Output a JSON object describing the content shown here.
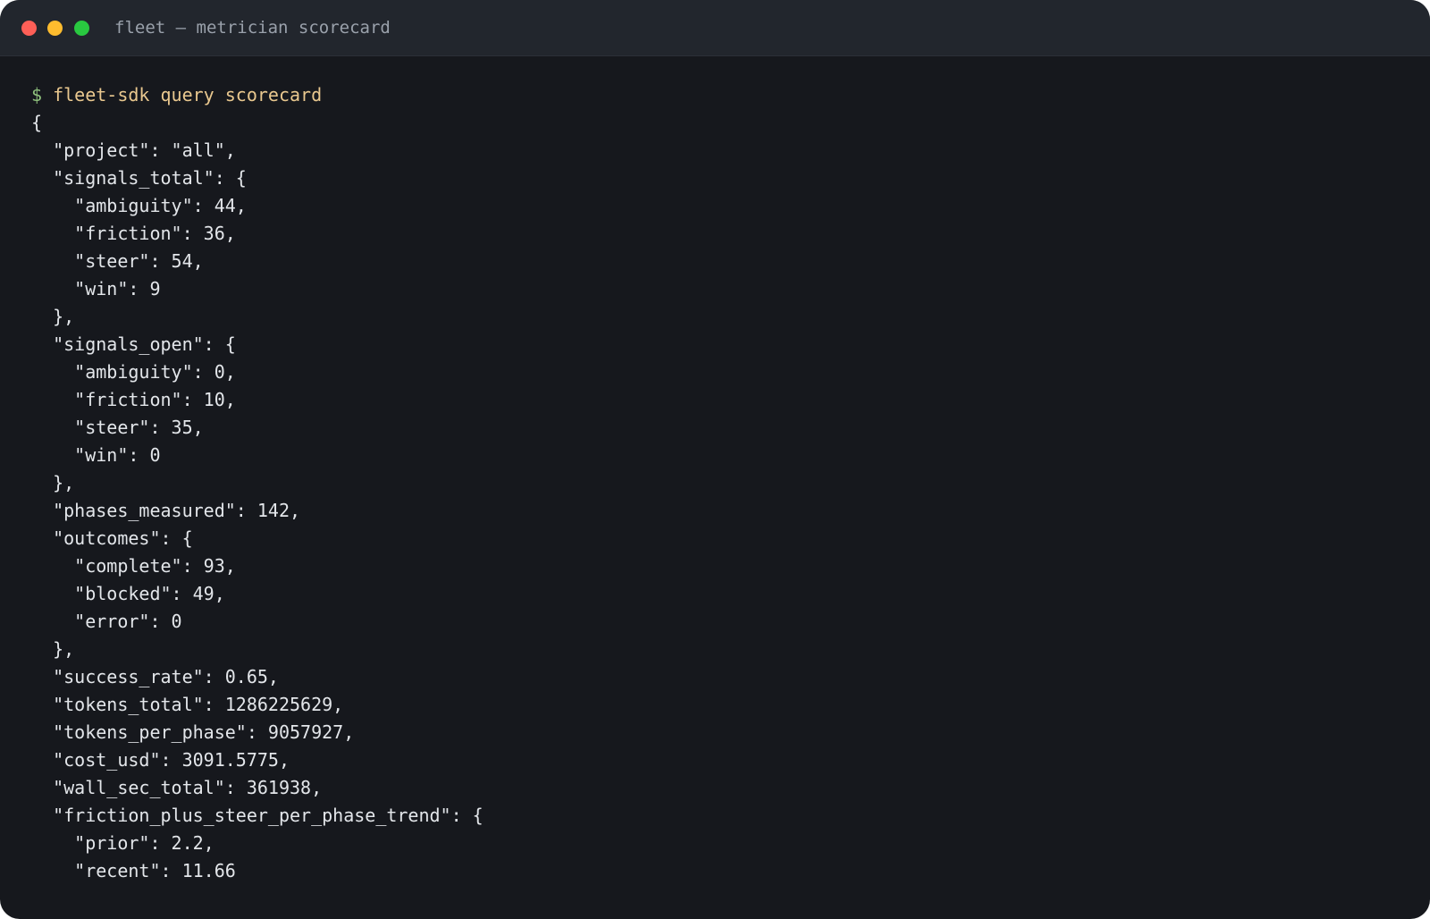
{
  "window": {
    "title": "fleet — metrician scorecard",
    "traffic_lights": {
      "close_color": "#fe5f57",
      "minimize_color": "#febc2e",
      "maximize_color": "#29c840"
    }
  },
  "terminal": {
    "prompt_symbol": "$",
    "command": "fleet-sdk query scorecard",
    "output_lines": [
      "{",
      "  \"project\": \"all\",",
      "  \"signals_total\": {",
      "    \"ambiguity\": 44,",
      "    \"friction\": 36,",
      "    \"steer\": 54,",
      "    \"win\": 9",
      "  },",
      "  \"signals_open\": {",
      "    \"ambiguity\": 0,",
      "    \"friction\": 10,",
      "    \"steer\": 35,",
      "    \"win\": 0",
      "  },",
      "  \"phases_measured\": 142,",
      "  \"outcomes\": {",
      "    \"complete\": 93,",
      "    \"blocked\": 49,",
      "    \"error\": 0",
      "  },",
      "  \"success_rate\": 0.65,",
      "  \"tokens_total\": 1286225629,",
      "  \"tokens_per_phase\": 9057927,",
      "  \"cost_usd\": 3091.5775,",
      "  \"wall_sec_total\": 361938,",
      "  \"friction_plus_steer_per_phase_trend\": {",
      "    \"prior\": 2.2,",
      "    \"recent\": 11.66"
    ]
  },
  "colors": {
    "background": "#16181d",
    "titlebar": "#22262d",
    "prompt": "#8ec07c",
    "command": "#e9c88f",
    "text": "#e3e6ea"
  }
}
